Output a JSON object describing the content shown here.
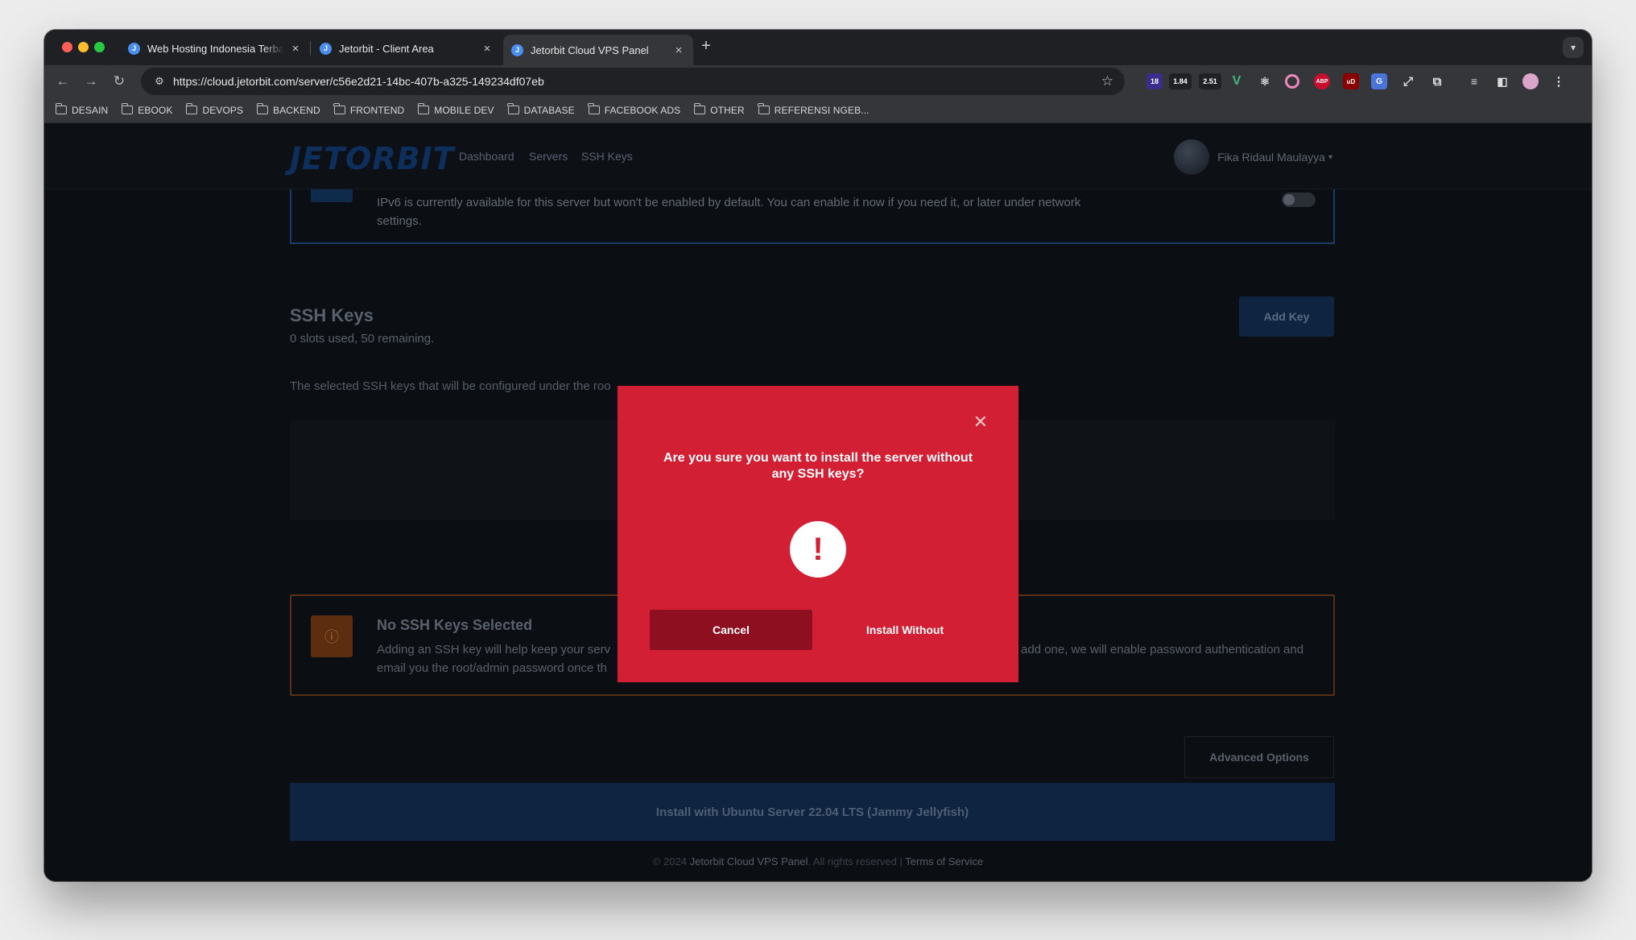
{
  "browser": {
    "tabs": [
      {
        "title": "Web Hosting Indonesia Terbaik",
        "close": "×"
      },
      {
        "title": "Jetorbit - Client Area",
        "close": "×"
      },
      {
        "title": "Jetorbit Cloud VPS Panel",
        "close": "×"
      }
    ],
    "new_tab": "+",
    "url": "https://cloud.jetorbit.com/server/c56e2d21-14bc-407b-a325-149234df07eb",
    "extensions": {
      "badge1": "18",
      "badge2": "1.84",
      "badge3": "2.51"
    },
    "bookmarks": [
      "DESAIN",
      "EBOOK",
      "DEVOPS",
      "BACKEND",
      "FRONTEND",
      "MOBILE DEV",
      "DATABASE",
      "FACEBOOK ADS",
      "OTHER",
      "REFERENSI NGEB..."
    ]
  },
  "site": {
    "logo": "JETORBIT",
    "nav": [
      "Dashboard",
      "Servers",
      "SSH Keys"
    ],
    "user": "Fika Ridaul Maulayya"
  },
  "ipv6": {
    "text": "IPv6 is currently available for this server but won't be enabled by default. You can enable it now if you need it, or later under network settings."
  },
  "ssh": {
    "title": "SSH Keys",
    "subtitle": "0 slots used, 50 remaining.",
    "add_key": "Add Key",
    "description": "The selected SSH keys that will be configured under the roo"
  },
  "warning": {
    "title": "No SSH Keys Selected",
    "text_left": "Adding an SSH key will help keep your serv",
    "text_left2": "email you the root/admin password once th",
    "text_right": "add one, we will enable password authentication and"
  },
  "advanced_options": "Advanced Options",
  "install_button": "Install with Ubuntu Server 22.04 LTS (Jammy Jellyfish)",
  "footer": {
    "copyright": "© 2024",
    "brand": "Jetorbit Cloud VPS Panel",
    "rights": ". All rights reserved |",
    "terms": "Terms of Service"
  },
  "modal": {
    "title": "Are you sure you want to install the server without any SSH keys?",
    "alert_glyph": "!",
    "cancel": "Cancel",
    "install_without": "Install Without"
  },
  "colors": {
    "modal_bg": "#d21f34",
    "cancel_bg": "#8e1020",
    "page_bg": "#0b0e12"
  }
}
